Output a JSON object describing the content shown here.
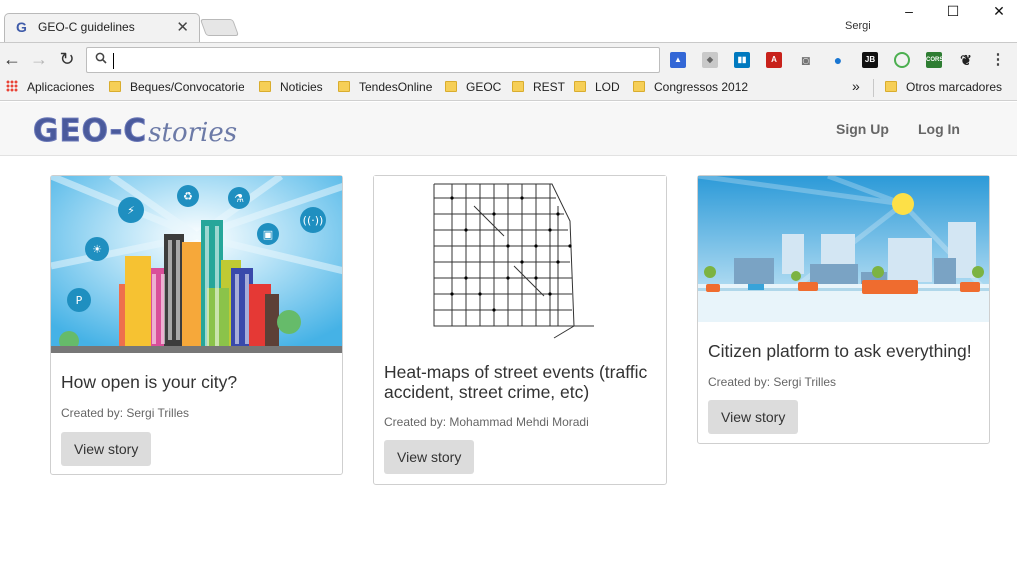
{
  "browser": {
    "tab_title": "GEO-C guidelines",
    "tab_favicon": "G",
    "user": "Sergi",
    "address_value": "",
    "window_controls": {
      "minimize": "–",
      "maximize": "☐",
      "close": "✕"
    },
    "extensions": [
      {
        "name": "graduation-cap-icon",
        "color": "#3367d6"
      },
      {
        "name": "box-icon",
        "color": "#9e9e9e"
      },
      {
        "name": "trello-icon",
        "color": "#0079bf"
      },
      {
        "name": "pdf-icon",
        "color": "#c8221b"
      },
      {
        "name": "camera-icon",
        "color": "#757575"
      },
      {
        "name": "drop-icon",
        "color": "#1976d2"
      },
      {
        "name": "jb-icon",
        "color": "#111111",
        "label": "JB"
      },
      {
        "name": "target-icon",
        "color": "#4caf50"
      },
      {
        "name": "cors-icon",
        "color": "#2e7d32",
        "label": "CORS"
      },
      {
        "name": "evernote-icon",
        "color": "#222222"
      }
    ]
  },
  "bookmarks": {
    "apps": "Aplicaciones",
    "items": [
      "Beques/Convocatorie",
      "Noticies",
      "TendesOnline",
      "GEOC",
      "REST",
      "LOD",
      "Congressos 2012"
    ],
    "overflow": "»",
    "other": "Otros marcadores"
  },
  "site": {
    "logo_main": "GEO-C",
    "logo_sub": "stories",
    "nav": {
      "signup": "Sign Up",
      "login": "Log In"
    }
  },
  "stories": [
    {
      "title": "How open is your city?",
      "author": "Created by: Sergi Trilles",
      "button": "View story"
    },
    {
      "title": "Heat-maps of street events (traffic accident, street crime, etc)",
      "author": "Created by: Mohammad Mehdi Moradi",
      "button": "View story"
    },
    {
      "title": "Citizen platform to ask everything!",
      "author": "Created by: Sergi Trilles",
      "button": "View story"
    }
  ]
}
